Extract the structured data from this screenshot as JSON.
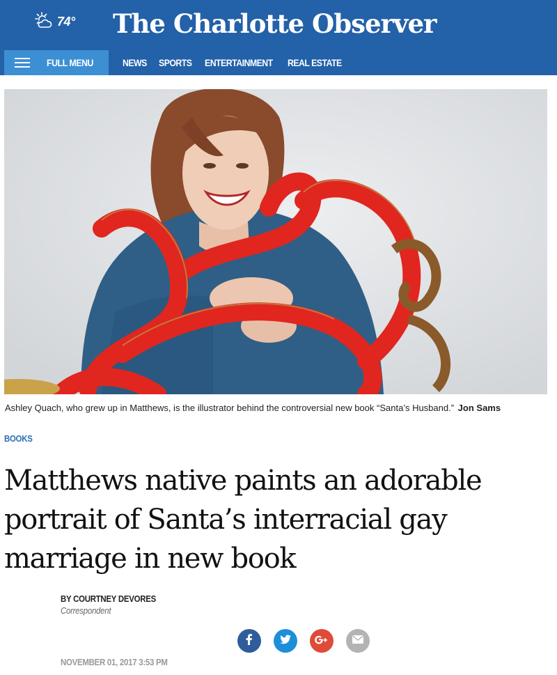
{
  "header": {
    "weather": {
      "icon": "partly-sunny-icon",
      "temperature": "74°"
    },
    "masthead": "The Charlotte Observer",
    "menu_label": "FULL MENU",
    "nav": [
      {
        "label": "NEWS"
      },
      {
        "label": "SPORTS"
      },
      {
        "label": "ENTERTAINMENT"
      },
      {
        "label": "REAL ESTATE"
      }
    ],
    "colors": {
      "bar": "#2361a8",
      "menu_button": "#3d8fd4"
    }
  },
  "article": {
    "caption": "Ashley Quach, who grew up in Matthews, is the illustrator behind the controversial new book “Santa’s Husband.”",
    "photo_credit": "Jon Sams",
    "section": "BOOKS",
    "headline": "Matthews native paints an adorable portrait of Santa’s interracial gay marriage in new book",
    "byline": "BY COURTNEY DEVORES",
    "author_role": "Correspondent",
    "share": [
      {
        "icon": "facebook-icon",
        "color": "#2f5d9c"
      },
      {
        "icon": "twitter-icon",
        "color": "#1d8fd9"
      },
      {
        "icon": "google-plus-icon",
        "color": "#de4b39"
      },
      {
        "icon": "email-icon",
        "color": "#b3b3b3"
      }
    ],
    "dateline": "NOVEMBER 01, 2017 3:53 PM"
  }
}
